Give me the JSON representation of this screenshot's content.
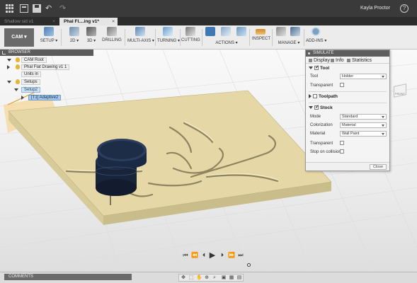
{
  "window": {
    "user_name": "Kayla Proctor",
    "help_symbol": "?"
  },
  "tabs": [
    {
      "label": "Shallow   sid v1",
      "close": "×"
    },
    {
      "label": "Phal Fl....ing v1*",
      "close": "×"
    }
  ],
  "ribbon": {
    "workspace": "CAM ▾",
    "groups": {
      "setup": "SETUP ▾",
      "two_d": "2D ▾",
      "three_d": "3D ▾",
      "drilling": "DRILLING",
      "multi_axis": "MULTI-AXIS ▾",
      "turning": "TURNING ▾",
      "cutting": "CUTTING",
      "actions": "ACTIONS ▾",
      "inspect": "INSPECT",
      "manage": "MANAGE ▾",
      "addins": "ADD-INS ▾"
    }
  },
  "viewcube": {
    "label": "FRONT"
  },
  "browser": {
    "title": "BROWSER",
    "nodes": {
      "root": "CAM Root",
      "drawing": "Phal Flat Drawing v1  1",
      "units": "Units  in",
      "setups": "Setups",
      "setup2": "Setup2",
      "adaptive": "[T1] Adaptive2"
    }
  },
  "simulate": {
    "title": "SIMULATE",
    "tabs": {
      "display": "Display",
      "info": "Info",
      "statistics": "Statistics"
    },
    "sections": {
      "tool": {
        "title": "Tool",
        "tool_label": "Tool",
        "tool_value": "Holder",
        "transparent_label": "Transparent"
      },
      "toolpath": {
        "title": "Toolpath"
      },
      "stock": {
        "title": "Stock",
        "mode_label": "Mode",
        "mode_value": "Standard",
        "colorization_label": "Colorization",
        "colorization_value": "Material",
        "material_label": "Material",
        "material_value": "Wall Paint",
        "transparent_label": "Transparent",
        "stop_label": "Stop on collision"
      }
    },
    "close_label": "Close"
  },
  "playback": {
    "first": "⏮",
    "prev": "⏪",
    "step_back": "⏴",
    "play": "▶",
    "step_fwd": "⏵",
    "next": "⏩",
    "last": "⏭"
  },
  "bottom": {
    "comments": "COMMENTS",
    "nav_icons": [
      "✥",
      "⬚",
      "✋",
      "⊕",
      "⌕",
      "▣",
      "▦",
      "▤"
    ]
  },
  "colors": {
    "stock": "#e6d8a6",
    "stock_side": "#c9bd8c",
    "tool": "#17243a",
    "selection": "#a9c9e8",
    "panel_header": "#5e5e5e"
  }
}
